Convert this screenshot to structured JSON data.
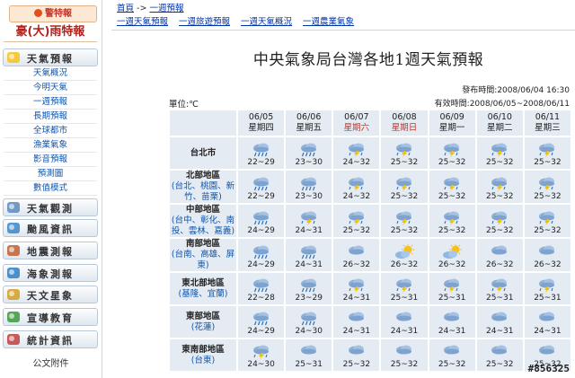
{
  "sidebar": {
    "alert_badge": "警特報",
    "alert_title": "豪(大)雨特報",
    "sections": [
      {
        "label": "天氣預報",
        "icon": "sun-cloud-icon"
      },
      {
        "label": "天氣觀測",
        "icon": "satellite-icon"
      },
      {
        "label": "颱風資訊",
        "icon": "typhoon-icon"
      },
      {
        "label": "地震測報",
        "icon": "earthquake-icon"
      },
      {
        "label": "海象測報",
        "icon": "wave-icon"
      },
      {
        "label": "天文星象",
        "icon": "star-icon"
      },
      {
        "label": "宣導教育",
        "icon": "book-icon"
      },
      {
        "label": "統計資訊",
        "icon": "stats-icon"
      }
    ],
    "subitems": [
      "天氣概況",
      "今明天氣",
      "一週預報",
      "長期預報",
      "全球都市",
      "漁業氣象",
      "影音預報",
      "預測圖",
      "數值模式"
    ],
    "attachment": "公文附件"
  },
  "breadcrumb": {
    "home": "首頁",
    "sep": "->",
    "current": "一週預報"
  },
  "tabs": [
    "一週天氣預報",
    "一週旅遊預報",
    "一週天氣概況",
    "一週農業氣象"
  ],
  "page": {
    "title": "中央氣象局台灣各地1週天氣預報",
    "issued": "發布時間:2008/06/04 16:30",
    "valid": "有效時間:2008/06/05~2008/06/11",
    "unit": "單位:℃"
  },
  "days": [
    {
      "date": "06/05",
      "weekday": "星期四",
      "weekend": false
    },
    {
      "date": "06/06",
      "weekday": "星期五",
      "weekend": false
    },
    {
      "date": "06/07",
      "weekday": "星期六",
      "weekend": true
    },
    {
      "date": "06/08",
      "weekday": "星期日",
      "weekend": true
    },
    {
      "date": "06/09",
      "weekday": "星期一",
      "weekend": false
    },
    {
      "date": "06/10",
      "weekday": "星期二",
      "weekend": false
    },
    {
      "date": "06/11",
      "weekday": "星期三",
      "weekend": false
    }
  ],
  "regions": [
    {
      "name": "台北市",
      "sub": "",
      "temps": [
        "22~29",
        "23~30",
        "24~32",
        "25~32",
        "25~32",
        "25~32",
        "25~32"
      ],
      "weather": [
        "rain",
        "rain",
        "thunder",
        "thunder",
        "thunder",
        "thunder",
        "thunder"
      ]
    },
    {
      "name": "北部地區",
      "sub": "(台北、桃園、新竹、苗栗)",
      "temps": [
        "22~29",
        "23~30",
        "24~32",
        "25~32",
        "25~32",
        "25~32",
        "25~32"
      ],
      "weather": [
        "rain",
        "rain",
        "thunder",
        "thunder",
        "thunder",
        "thunder",
        "thunder"
      ]
    },
    {
      "name": "中部地區",
      "sub": "(台中、彰化、南投、雲林、嘉義)",
      "temps": [
        "24~29",
        "24~31",
        "25~32",
        "25~32",
        "25~32",
        "25~32",
        "25~32"
      ],
      "weather": [
        "rain",
        "thunder",
        "thunder",
        "thunder",
        "thunder",
        "thunder",
        "thunder"
      ]
    },
    {
      "name": "南部地區",
      "sub": "(台南、高雄、屏東)",
      "temps": [
        "24~29",
        "24~31",
        "26~32",
        "26~32",
        "26~32",
        "26~32",
        "26~32"
      ],
      "weather": [
        "rain",
        "rain",
        "cloud",
        "sun-cloud",
        "sun-cloud",
        "cloud",
        "cloud"
      ]
    },
    {
      "name": "東北部地區",
      "sub": "(基隆、宜蘭)",
      "temps": [
        "22~28",
        "23~29",
        "24~31",
        "25~31",
        "25~31",
        "25~31",
        "25~31"
      ],
      "weather": [
        "rain",
        "rain",
        "thunder",
        "thunder",
        "thunder",
        "thunder",
        "thunder"
      ]
    },
    {
      "name": "東部地區",
      "sub": "(花蓮)",
      "temps": [
        "24~29",
        "24~30",
        "24~31",
        "24~31",
        "24~31",
        "24~31",
        "24~31"
      ],
      "weather": [
        "rain",
        "rain",
        "cloud",
        "cloud",
        "cloud",
        "cloud",
        "cloud"
      ]
    },
    {
      "name": "東南部地區",
      "sub": "(台東)",
      "temps": [
        "24~30",
        "25~31",
        "25~32",
        "25~32",
        "25~32",
        "25~32",
        "25~32"
      ],
      "weather": [
        "thunder",
        "cloud",
        "cloud",
        "cloud",
        "cloud",
        "cloud",
        "cloud"
      ]
    }
  ],
  "watermark": "#856325",
  "colors": {
    "accent_blue": "#1155aa",
    "weekend_red": "#c0392b",
    "cell_bg": "#e4ebf3"
  }
}
